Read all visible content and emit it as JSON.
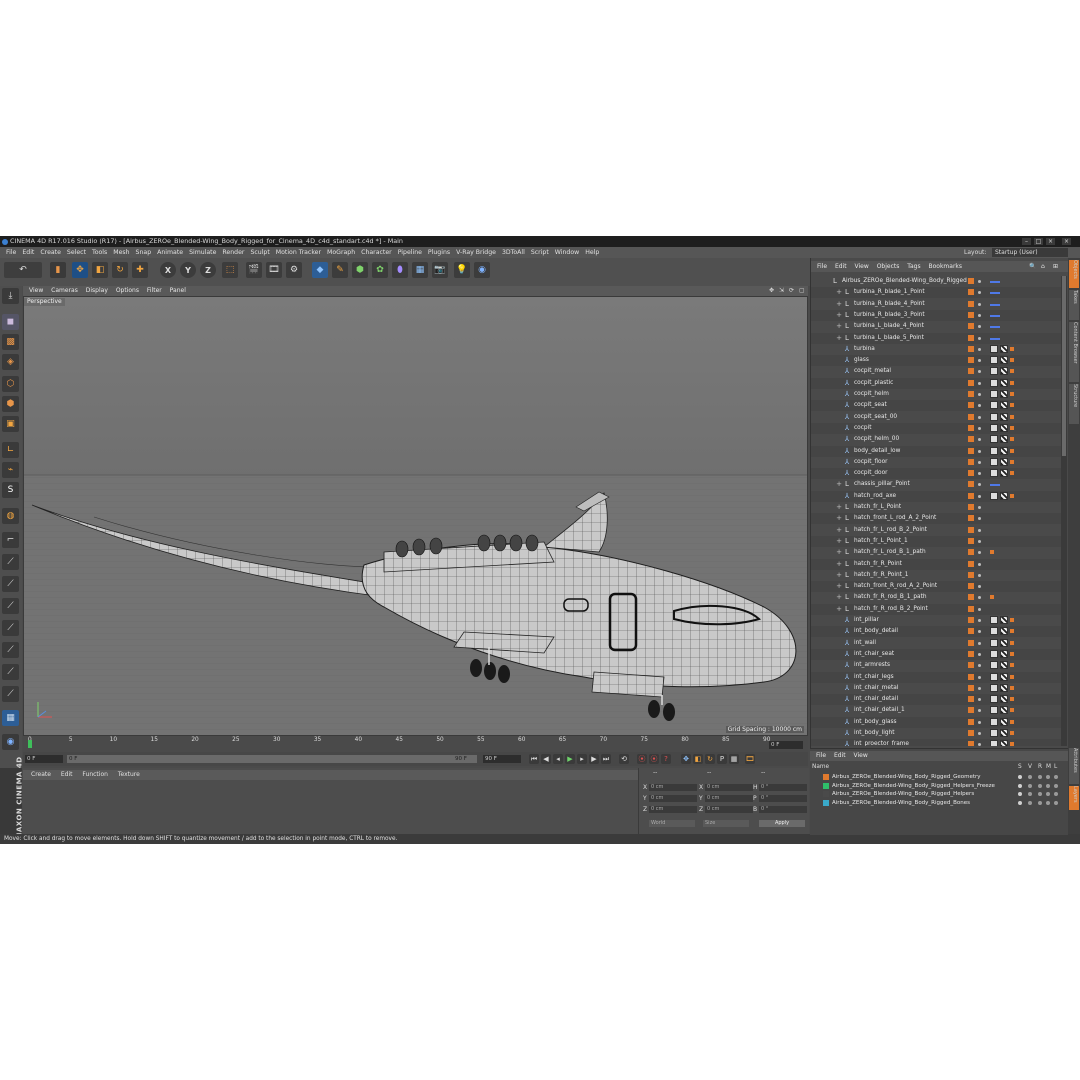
{
  "window": {
    "title": "CINEMA 4D R17.016 Studio (R17) - [Airbus_ZEROe_Blended-Wing_Body_Rigged_for_Cinema_4D_c4d_standart.c4d *] - Main"
  },
  "menubar": [
    "File",
    "Edit",
    "Create",
    "Select",
    "Tools",
    "Mesh",
    "Snap",
    "Animate",
    "Simulate",
    "Render",
    "Sculpt",
    "Motion Tracker",
    "MoGraph",
    "Character",
    "Pipeline",
    "Plugins",
    "V-Ray Bridge",
    "3DToAll",
    "Script",
    "Window",
    "Help"
  ],
  "layout": {
    "label": "Layout:",
    "value": "Startup (User)"
  },
  "viewport": {
    "menu": [
      "View",
      "Cameras",
      "Display",
      "Options",
      "Filter",
      "Panel"
    ],
    "camera_label": "Perspective",
    "grid_spacing": "Grid Spacing : 10000 cm"
  },
  "timeline": {
    "ticks": [
      "0",
      "5",
      "10",
      "15",
      "20",
      "25",
      "30",
      "35",
      "40",
      "45",
      "50",
      "55",
      "60",
      "65",
      "70",
      "75",
      "80",
      "85",
      "90"
    ],
    "current_frame_right": "0 F",
    "start_field": "0 F",
    "min_field": "0 F",
    "end_field": "90 F",
    "max_field": "90 F"
  },
  "material_manager": {
    "menu": [
      "Create",
      "Edit",
      "Function",
      "Texture"
    ]
  },
  "coordinates": {
    "header": [
      "--",
      "--",
      "--"
    ],
    "rows": [
      {
        "axis": "X",
        "pos": "0 cm",
        "axis2": "X",
        "size": "0 cm",
        "axis3": "H",
        "rot": "0 °"
      },
      {
        "axis": "Y",
        "pos": "0 cm",
        "axis2": "Y",
        "size": "0 cm",
        "axis3": "P",
        "rot": "0 °"
      },
      {
        "axis": "Z",
        "pos": "0 cm",
        "axis2": "Z",
        "size": "0 cm",
        "axis3": "B",
        "rot": "0 °"
      }
    ],
    "world_dropdown": "World",
    "size_dropdown": "Size",
    "apply_label": "Apply"
  },
  "brand": "MAXON CINEMA 4D",
  "status": "Move: Click and drag to move elements. Hold down SHIFT to quantize movement / add to the selection in point mode, CTRL to remove.",
  "object_manager": {
    "menu": [
      "File",
      "Edit",
      "View",
      "Objects",
      "Tags",
      "Bookmarks"
    ],
    "objects": [
      {
        "name": "Airbus_ZEROe_Blended-Wing_Body_Rigged",
        "icon": "null",
        "indent": 0,
        "tags": [
          "blue"
        ]
      },
      {
        "name": "turbina_R_blade_1_Point",
        "icon": "null",
        "indent": 1,
        "tags": [
          "blue"
        ]
      },
      {
        "name": "turbina_R_blade_4_Point",
        "icon": "null",
        "indent": 1,
        "tags": [
          "blue"
        ]
      },
      {
        "name": "turbina_R_blade_3_Point",
        "icon": "null",
        "indent": 1,
        "tags": [
          "blue"
        ]
      },
      {
        "name": "turbina_L_blade_4_Point",
        "icon": "null",
        "indent": 1,
        "tags": [
          "blue"
        ]
      },
      {
        "name": "turbina_L_blade_5_Point",
        "icon": "null",
        "indent": 1,
        "tags": [
          "blue"
        ]
      },
      {
        "name": "turbina",
        "icon": "bone",
        "indent": 1,
        "tags": [
          "mat",
          "chk",
          "dot"
        ]
      },
      {
        "name": "glass",
        "icon": "bone",
        "indent": 1,
        "tags": [
          "mat",
          "chk",
          "dot"
        ]
      },
      {
        "name": "cocpit_metal",
        "icon": "bone",
        "indent": 1,
        "tags": [
          "mat",
          "chk",
          "dot"
        ]
      },
      {
        "name": "cocpit_plastic",
        "icon": "bone",
        "indent": 1,
        "tags": [
          "mat",
          "chk",
          "dot"
        ]
      },
      {
        "name": "cocpit_helm",
        "icon": "bone",
        "indent": 1,
        "tags": [
          "mat",
          "chk",
          "dot"
        ]
      },
      {
        "name": "cocpit_seat",
        "icon": "bone",
        "indent": 1,
        "tags": [
          "mat",
          "chk",
          "dot"
        ]
      },
      {
        "name": "cocpit_seat_00",
        "icon": "bone",
        "indent": 1,
        "tags": [
          "mat",
          "chk",
          "dot"
        ]
      },
      {
        "name": "cocpit",
        "icon": "bone",
        "indent": 1,
        "tags": [
          "mat",
          "chk",
          "dot"
        ]
      },
      {
        "name": "cocpit_helm_00",
        "icon": "bone",
        "indent": 1,
        "tags": [
          "mat",
          "chk",
          "dot"
        ]
      },
      {
        "name": "body_detail_low",
        "icon": "bone",
        "indent": 1,
        "tags": [
          "mat",
          "chk",
          "dot"
        ]
      },
      {
        "name": "cocpit_floor",
        "icon": "bone",
        "indent": 1,
        "tags": [
          "mat",
          "chk",
          "dot"
        ]
      },
      {
        "name": "cocpit_door",
        "icon": "bone",
        "indent": 1,
        "tags": [
          "mat",
          "chk",
          "dot"
        ]
      },
      {
        "name": "chassis_pillar_Point",
        "icon": "null",
        "indent": 1,
        "tags": [
          "blue"
        ]
      },
      {
        "name": "hatch_rod_axe",
        "icon": "bone",
        "indent": 1,
        "tags": [
          "mat",
          "chk",
          "dot"
        ]
      },
      {
        "name": "hatch_fr_L_Point",
        "icon": "null",
        "indent": 1,
        "tags": []
      },
      {
        "name": "hatch_front_L_rod_A_2_Point",
        "icon": "null",
        "indent": 1,
        "tags": []
      },
      {
        "name": "hatch_fr_L_rod_B_2_Point",
        "icon": "null",
        "indent": 1,
        "tags": []
      },
      {
        "name": "hatch_fr_L_Point_1",
        "icon": "null",
        "indent": 1,
        "tags": []
      },
      {
        "name": "hatch_fr_L_rod_B_1_path",
        "icon": "null",
        "indent": 1,
        "tags": [
          "dot"
        ]
      },
      {
        "name": "hatch_fr_R_Point",
        "icon": "null",
        "indent": 1,
        "tags": []
      },
      {
        "name": "hatch_fr_R_Point_1",
        "icon": "null",
        "indent": 1,
        "tags": []
      },
      {
        "name": "hatch_front_R_rod_A_2_Point",
        "icon": "null",
        "indent": 1,
        "tags": []
      },
      {
        "name": "hatch_fr_R_rod_B_1_path",
        "icon": "null",
        "indent": 1,
        "tags": [
          "dot"
        ]
      },
      {
        "name": "hatch_fr_R_rod_B_2_Point",
        "icon": "null",
        "indent": 1,
        "tags": []
      },
      {
        "name": "int_pillar",
        "icon": "bone",
        "indent": 1,
        "tags": [
          "mat",
          "chk",
          "dot"
        ]
      },
      {
        "name": "int_body_detail",
        "icon": "bone",
        "indent": 1,
        "tags": [
          "mat",
          "chk",
          "dot"
        ]
      },
      {
        "name": "int_wall",
        "icon": "bone",
        "indent": 1,
        "tags": [
          "mat",
          "chk",
          "dot"
        ]
      },
      {
        "name": "int_chair_seat",
        "icon": "bone",
        "indent": 1,
        "tags": [
          "mat",
          "chk",
          "dot"
        ]
      },
      {
        "name": "int_armrests",
        "icon": "bone",
        "indent": 1,
        "tags": [
          "mat",
          "chk",
          "dot"
        ]
      },
      {
        "name": "int_chair_legs",
        "icon": "bone",
        "indent": 1,
        "tags": [
          "mat",
          "chk",
          "dot"
        ]
      },
      {
        "name": "int_chair_metal",
        "icon": "bone",
        "indent": 1,
        "tags": [
          "mat",
          "chk",
          "dot"
        ]
      },
      {
        "name": "int_chair_detail",
        "icon": "bone",
        "indent": 1,
        "tags": [
          "mat",
          "chk",
          "dot"
        ]
      },
      {
        "name": "int_chair_detail_1",
        "icon": "bone",
        "indent": 1,
        "tags": [
          "mat",
          "chk",
          "dot"
        ]
      },
      {
        "name": "int_body_glass",
        "icon": "bone",
        "indent": 1,
        "tags": [
          "mat",
          "chk",
          "dot"
        ]
      },
      {
        "name": "int_body_light",
        "icon": "bone",
        "indent": 1,
        "tags": [
          "mat",
          "chk",
          "dot"
        ]
      },
      {
        "name": "int_proector_frame",
        "icon": "bone",
        "indent": 1,
        "tags": [
          "mat",
          "chk",
          "dot"
        ]
      }
    ]
  },
  "layer_manager": {
    "menu": [
      "File",
      "Edit",
      "View"
    ],
    "name_header": "Name",
    "col_headers": [
      "S",
      "V",
      "R",
      "M",
      "L"
    ],
    "layers": [
      {
        "name": "Airbus_ZEROe_Blended-Wing_Body_Rigged_Geometry",
        "color": "#e07a2e"
      },
      {
        "name": "Airbus_ZEROe_Blended-Wing_Body_Rigged_Helpers_Freeze",
        "color": "#2fbf6a"
      },
      {
        "name": "Airbus_ZEROe_Blended-Wing_Body_Rigged_Helpers",
        "color": "#4a4a4a"
      },
      {
        "name": "Airbus_ZEROe_Blended-Wing_Body_Rigged_Bones",
        "color": "#3aa9c9"
      }
    ]
  },
  "side_tabs": [
    "Objects",
    "Takes",
    "Content Browser",
    "Structure"
  ],
  "side_tabs_lower": [
    "Attributes",
    "Layers"
  ]
}
